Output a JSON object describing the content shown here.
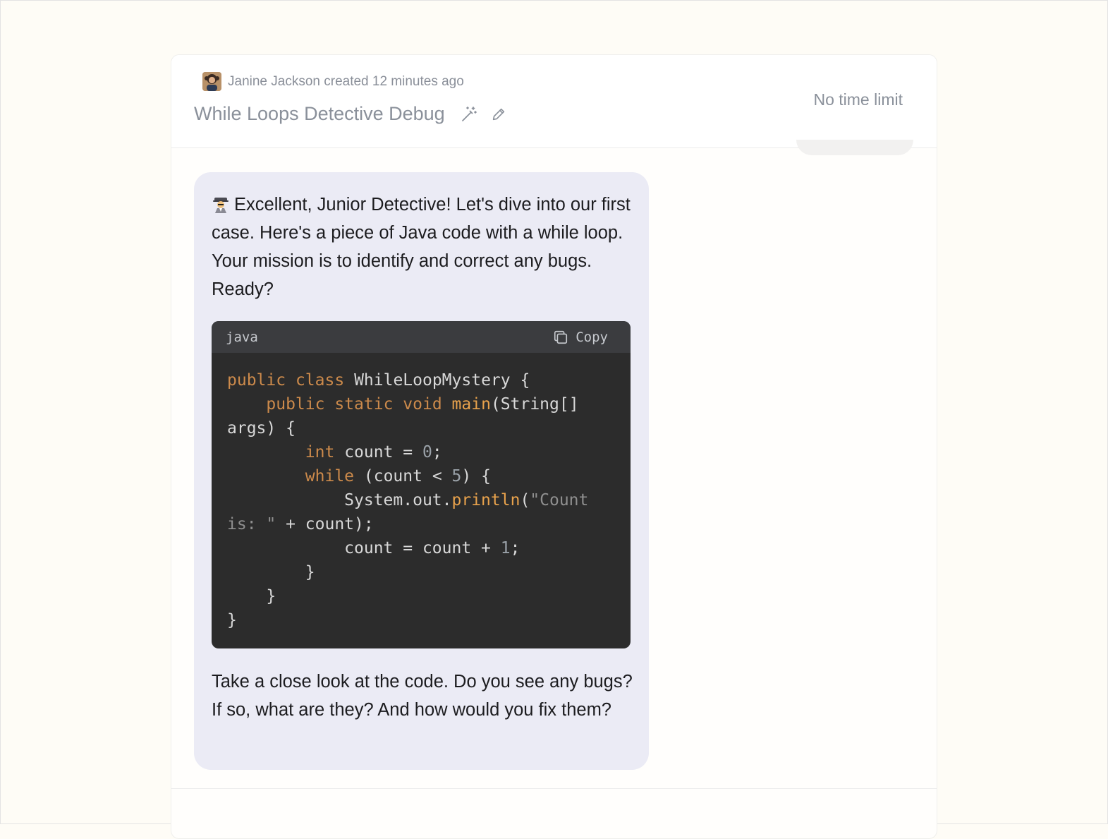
{
  "header": {
    "creator_name": "Janine Jackson",
    "created_text": "Janine Jackson created 12 minutes ago",
    "title": "While Loops Detective Debug",
    "time_limit": "No time limit"
  },
  "icons": {
    "magic": "magic-wand-icon",
    "edit": "pencil-icon",
    "copy": "copy-icon",
    "detective": "detective-emoji"
  },
  "message": {
    "intro": "Excellent, Junior Detective! Let's dive into our first case. Here's a piece of Java code with a while loop. Your mission is to identify and correct any bugs. Ready?",
    "outro": "Take a close look at the code. Do you see any bugs? If so, what are they? And how would you fix them?"
  },
  "code": {
    "language": "java",
    "copy_label": "Copy",
    "t_public": "public",
    "t_class": "class",
    "t_classname": "WhileLoopMystery {",
    "t_public2": "public",
    "t_static": "static",
    "t_void": "void",
    "t_main": "main",
    "t_mainparams": "(String[]",
    "t_args": "args) {",
    "t_int": "int",
    "t_count_decl": "count = ",
    "t_zero": "0",
    "t_semi1": ";",
    "t_while": "while",
    "t_cond_a": "(count < ",
    "t_five": "5",
    "t_cond_b": ") {",
    "t_sysout": "System.out.",
    "t_println": "println",
    "t_paren": "(",
    "t_str_a": "\"Count",
    "t_str_b": "is: \"",
    "t_concat": " + count);",
    "t_incr": "count = count + ",
    "t_one": "1",
    "t_semi2": ";",
    "t_close1": "}",
    "t_close2": "}",
    "t_close3": "}"
  },
  "colors": {
    "background": "#fefcf6",
    "bubble": "#ebebf5",
    "code_bg": "#2c2c2c",
    "keyword": "#cc8a4b",
    "function": "#e8a24c"
  }
}
